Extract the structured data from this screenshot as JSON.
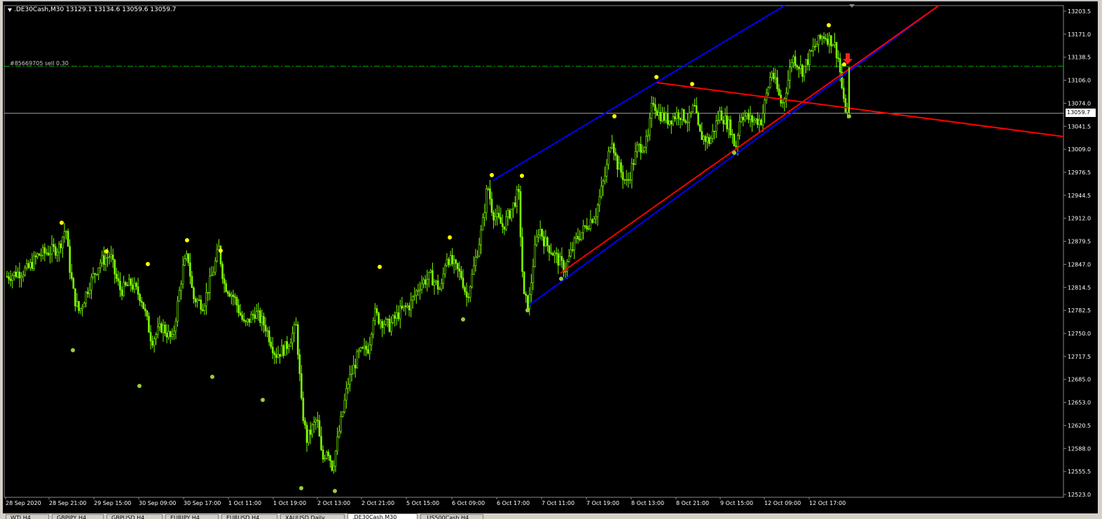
{
  "chart_header": {
    "symbol_line": ".DE30Cash,M30  13129.1 13134.6 13059.6 13059.7"
  },
  "order_line": {
    "label": "#85669705 sell 0.30",
    "price": 13126.0
  },
  "current_price": {
    "label": "13059.7",
    "value": 13059.7
  },
  "tabs": [
    {
      "label": "WTI,H4",
      "active": false
    },
    {
      "label": "GBPJPY,H4",
      "active": false
    },
    {
      "label": "GBPUSD,H4",
      "active": false
    },
    {
      "label": "EURJPY,H4",
      "active": false
    },
    {
      "label": "EURUSD,H4",
      "active": false
    },
    {
      "label": "XAUUSD,Daily",
      "active": false
    },
    {
      "label": ".DE30Cash,M30",
      "active": true
    },
    {
      "label": ".US500Cash,H4",
      "active": false
    }
  ],
  "colors": {
    "background": "#000000",
    "candle": "#7CFC00",
    "channel_line": "#0000FF",
    "trend_line": "#FF0000",
    "fractal_high": "#FFFF00",
    "fractal_low": "#9ACD32",
    "order_line": "#00AA00",
    "bid_line": "#A0A0A0"
  },
  "chart_data": {
    "type": "candlestick",
    "symbol": ".DE30Cash",
    "timeframe": "M30",
    "ylim": [
      12523.0,
      13203.5
    ],
    "y_ticks": [
      "13203.5",
      "13171.0",
      "13138.5",
      "13106.0",
      "13074.0",
      "13041.5",
      "13009.0",
      "12976.5",
      "12944.5",
      "12912.0",
      "12879.5",
      "12847.0",
      "12814.5",
      "12782.5",
      "12750.0",
      "12717.5",
      "12685.0",
      "12653.0",
      "12620.5",
      "12588.0",
      "12555.5",
      "12523.0"
    ],
    "x_ticks": [
      "28 Sep 2020",
      "28 Sep 21:00",
      "29 Sep 15:00",
      "30 Sep 09:00",
      "30 Sep 17:00",
      "1 Oct 11:00",
      "1 Oct 19:00",
      "2 Oct 13:00",
      "2 Oct 21:00",
      "5 Oct 15:00",
      "6 Oct 09:00",
      "6 Oct 17:00",
      "7 Oct 11:00",
      "7 Oct 19:00",
      "8 Oct 13:00",
      "8 Oct 21:00",
      "9 Oct 15:00",
      "12 Oct 09:00",
      "12 Oct 17:00"
    ],
    "close_path": [
      [
        0,
        12830
      ],
      [
        0.02,
        12840
      ],
      [
        0.03,
        12860
      ],
      [
        0.05,
        12870
      ],
      [
        0.057,
        12900
      ],
      [
        0.06,
        12850
      ],
      [
        0.065,
        12800
      ],
      [
        0.07,
        12780
      ],
      [
        0.08,
        12820
      ],
      [
        0.09,
        12850
      ],
      [
        0.1,
        12860
      ],
      [
        0.105,
        12830
      ],
      [
        0.11,
        12810
      ],
      [
        0.12,
        12820
      ],
      [
        0.13,
        12800
      ],
      [
        0.14,
        12740
      ],
      [
        0.15,
        12760
      ],
      [
        0.16,
        12740
      ],
      [
        0.17,
        12840
      ],
      [
        0.175,
        12860
      ],
      [
        0.18,
        12800
      ],
      [
        0.19,
        12790
      ],
      [
        0.2,
        12840
      ],
      [
        0.205,
        12870
      ],
      [
        0.21,
        12820
      ],
      [
        0.22,
        12800
      ],
      [
        0.23,
        12760
      ],
      [
        0.24,
        12780
      ],
      [
        0.25,
        12760
      ],
      [
        0.26,
        12720
      ],
      [
        0.27,
        12730
      ],
      [
        0.28,
        12760
      ],
      [
        0.285,
        12650
      ],
      [
        0.29,
        12600
      ],
      [
        0.3,
        12630
      ],
      [
        0.305,
        12570
      ],
      [
        0.31,
        12590
      ],
      [
        0.315,
        12560
      ],
      [
        0.32,
        12600
      ],
      [
        0.33,
        12680
      ],
      [
        0.34,
        12720
      ],
      [
        0.35,
        12730
      ],
      [
        0.355,
        12780
      ],
      [
        0.36,
        12770
      ],
      [
        0.37,
        12760
      ],
      [
        0.38,
        12780
      ],
      [
        0.39,
        12790
      ],
      [
        0.4,
        12820
      ],
      [
        0.41,
        12830
      ],
      [
        0.42,
        12810
      ],
      [
        0.425,
        12860
      ],
      [
        0.43,
        12850
      ],
      [
        0.44,
        12830
      ],
      [
        0.445,
        12800
      ],
      [
        0.45,
        12830
      ],
      [
        0.46,
        12900
      ],
      [
        0.465,
        12960
      ],
      [
        0.47,
        12920
      ],
      [
        0.48,
        12900
      ],
      [
        0.49,
        12930
      ],
      [
        0.495,
        12950
      ],
      [
        0.5,
        12800
      ],
      [
        0.505,
        12790
      ],
      [
        0.51,
        12860
      ],
      [
        0.515,
        12900
      ],
      [
        0.52,
        12880
      ],
      [
        0.53,
        12860
      ],
      [
        0.54,
        12840
      ],
      [
        0.55,
        12880
      ],
      [
        0.56,
        12900
      ],
      [
        0.57,
        12920
      ],
      [
        0.575,
        12950
      ],
      [
        0.58,
        12980
      ],
      [
        0.585,
        13030
      ],
      [
        0.59,
        12990
      ],
      [
        0.6,
        12960
      ],
      [
        0.61,
        13010
      ],
      [
        0.62,
        13020
      ],
      [
        0.625,
        13080
      ],
      [
        0.63,
        13060
      ],
      [
        0.64,
        13050
      ],
      [
        0.65,
        13060
      ],
      [
        0.66,
        13050
      ],
      [
        0.665,
        13070
      ],
      [
        0.67,
        13030
      ],
      [
        0.68,
        13020
      ],
      [
        0.69,
        13060
      ],
      [
        0.695,
        13050
      ],
      [
        0.7,
        13040
      ],
      [
        0.705,
        13010
      ],
      [
        0.71,
        13060
      ],
      [
        0.72,
        13050
      ],
      [
        0.73,
        13050
      ],
      [
        0.74,
        13120
      ],
      [
        0.75,
        13070
      ],
      [
        0.755,
        13100
      ],
      [
        0.76,
        13140
      ],
      [
        0.77,
        13120
      ],
      [
        0.78,
        13150
      ],
      [
        0.79,
        13170
      ],
      [
        0.8,
        13160
      ],
      [
        0.805,
        13135
      ],
      [
        0.81,
        13070
      ],
      [
        0.815,
        13059.7
      ]
    ],
    "fractals_high_count": 16,
    "fractals_low_count": 11,
    "trendlines": [
      {
        "name": "channel-upper",
        "color": "blue"
      },
      {
        "name": "channel-lower",
        "color": "blue"
      },
      {
        "name": "support-red",
        "color": "red"
      },
      {
        "name": "resistance-red",
        "color": "red"
      }
    ]
  }
}
